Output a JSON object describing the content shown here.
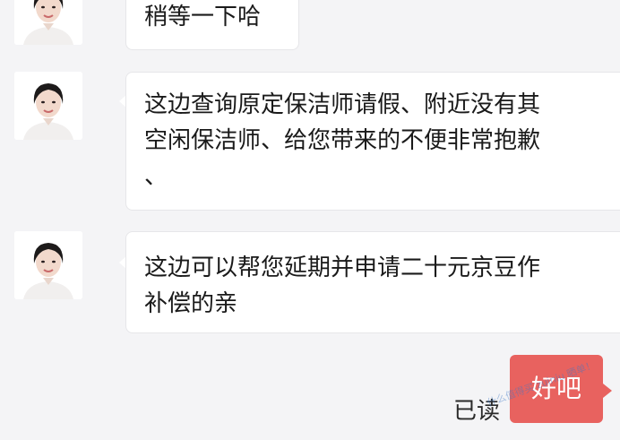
{
  "messages": [
    {
      "sender": "agent",
      "lines": [
        "稍等一下哈"
      ]
    },
    {
      "sender": "agent",
      "lines": [
        "这边查询原定保洁师请假、附近没有其",
        "空闲保洁师、给您带来的不便非常抱歉",
        "、"
      ]
    },
    {
      "sender": "agent",
      "lines": [
        "这边可以帮您延期并申请二十元京豆作",
        "补偿的亲"
      ]
    }
  ],
  "my_message": {
    "text": "好吧",
    "status": "已读",
    "bubble_color": "#e8625f"
  },
  "watermark": "什么值得买 zuiniu 晒单！",
  "icons": {
    "avatar": "agent-avatar-photo"
  }
}
